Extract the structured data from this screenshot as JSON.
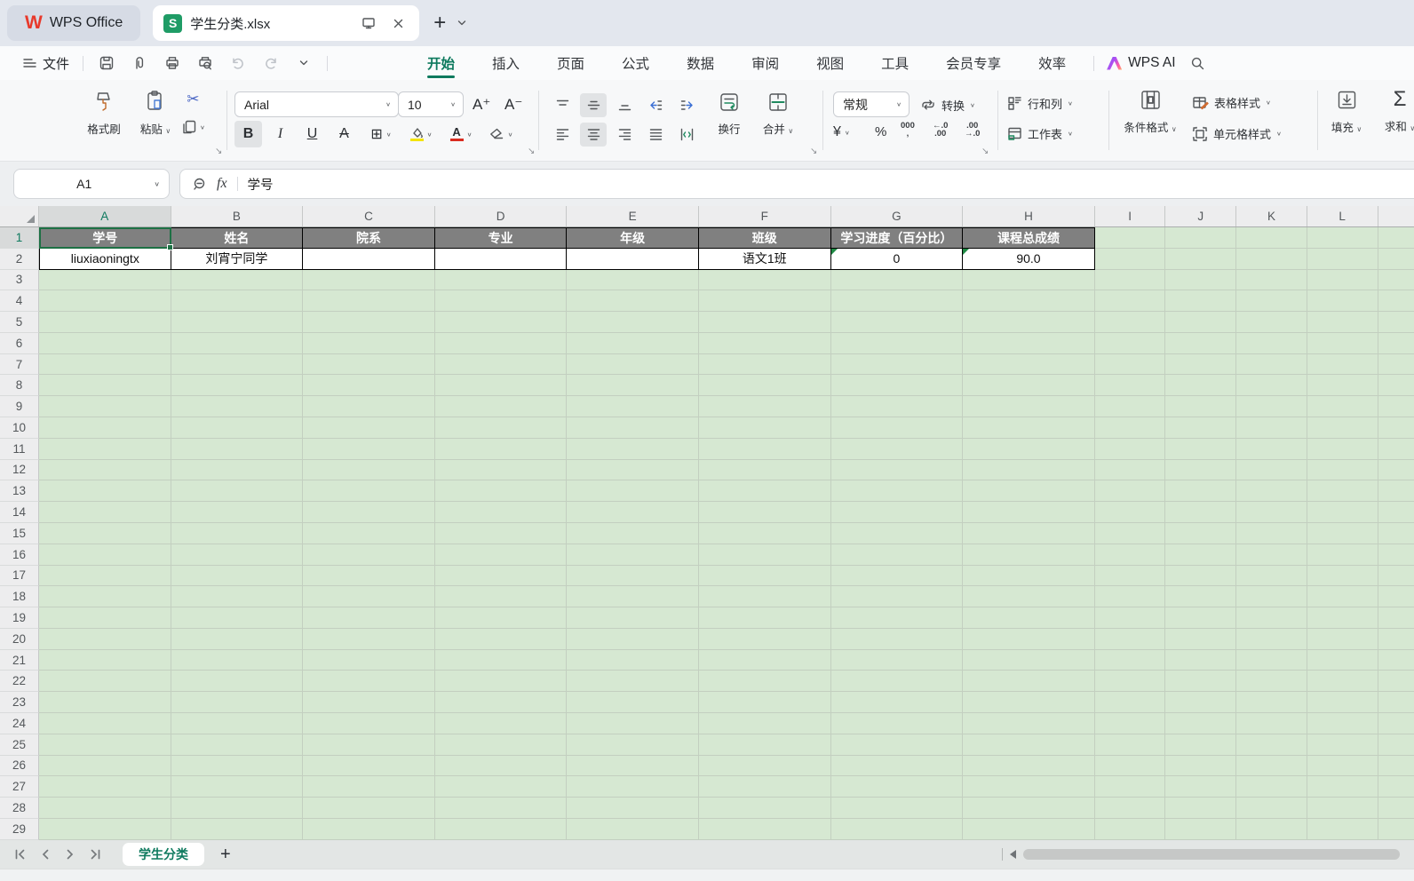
{
  "title_bar": {
    "app_name": "WPS Office",
    "doc_tab": {
      "title": "学生分类.xlsx"
    }
  },
  "menu_bar": {
    "file_label": "文件",
    "tabs": [
      {
        "label": "开始",
        "active": true
      },
      {
        "label": "插入",
        "active": false
      },
      {
        "label": "页面",
        "active": false
      },
      {
        "label": "公式",
        "active": false
      },
      {
        "label": "数据",
        "active": false
      },
      {
        "label": "审阅",
        "active": false
      },
      {
        "label": "视图",
        "active": false
      },
      {
        "label": "工具",
        "active": false
      },
      {
        "label": "会员专享",
        "active": false
      },
      {
        "label": "效率",
        "active": false
      }
    ],
    "wps_ai_label": "WPS AI"
  },
  "ribbon": {
    "format_painter_label": "格式刷",
    "paste_label": "粘贴",
    "font_name": "Arial",
    "font_size": "10",
    "bold_label": "B",
    "italic_label": "I",
    "underline_label": "U",
    "strikethrough_label": "A",
    "font_increase_label": "A⁺",
    "font_decrease_label": "A⁻",
    "font_color_glyph": "A",
    "wrap_label": "换行",
    "merge_label": "合并",
    "number_format_value": "常规",
    "convert_label": "转换",
    "currency_label": "¥",
    "percent_label": "%",
    "thousands_top": "000",
    "thousands_bottom": ",",
    "inc_decimal_top": "←.0",
    "inc_decimal_bottom": ".00",
    "dec_decimal_top": ".00",
    "dec_decimal_bottom": "→.0",
    "rows_cols_label": "行和列",
    "worksheet_label": "工作表",
    "conditional_format_label": "条件格式",
    "table_style_label": "表格样式",
    "cell_style_label": "单元格样式",
    "fill_label": "填充",
    "sum_label": "求和"
  },
  "formula_bar": {
    "cell_ref": "A1",
    "fx_label": "fx",
    "content": "学号"
  },
  "grid": {
    "visible_columns": [
      "A",
      "B",
      "C",
      "D",
      "E",
      "F",
      "G",
      "H",
      "I",
      "J",
      "K",
      "L"
    ],
    "visible_row_count": 29,
    "selected_cell": "A1",
    "table": {
      "header_row": [
        "学号",
        "姓名",
        "院系",
        "专业",
        "年级",
        "班级",
        "学习进度（百分比）",
        "课程总成绩"
      ],
      "data_rows": [
        [
          "liuxiaoningtx",
          "刘宵宁同学",
          "",
          "",
          "",
          "语文1班",
          "0",
          "90.0"
        ]
      ],
      "error_flag_cells": [
        "G2",
        "H2"
      ]
    },
    "colors": {
      "table_header_bg": "#808080",
      "table_header_text": "#ffffff",
      "sheet_fill": "#d6e8d2",
      "selection_border": "#1d7044",
      "accent_teal": "#0e7a5e"
    }
  },
  "sheet_bar": {
    "tabs": [
      {
        "label": "学生分类",
        "active": true
      }
    ]
  }
}
